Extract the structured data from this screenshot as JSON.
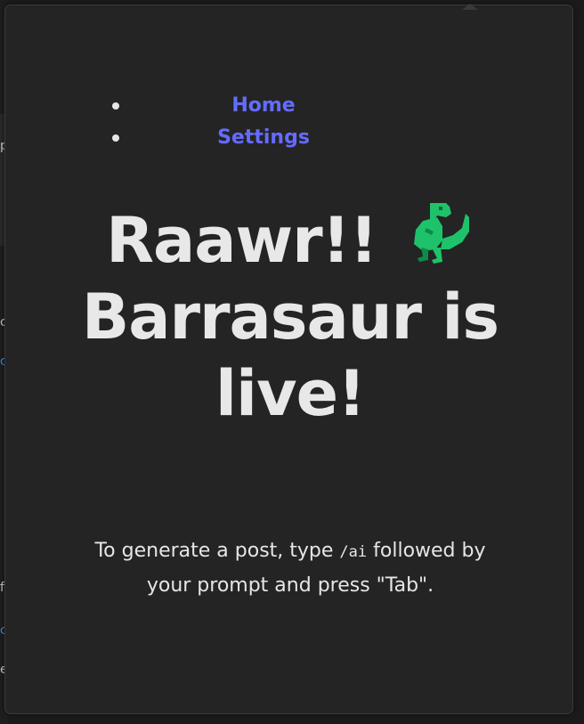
{
  "nav": {
    "items": [
      {
        "label": "Home"
      },
      {
        "label": "Settings"
      }
    ]
  },
  "headline": {
    "line1": "Raawr!!",
    "line2": "Barrasaur is",
    "line3": "live!",
    "icon": "t-rex-icon"
  },
  "hint": {
    "before_code": "To generate a post, type ",
    "code": "/ai",
    "after_code": " followed by your prompt and press \"Tab\"."
  },
  "colors": {
    "link": "#646cff",
    "text": "#e8e8e8",
    "background": "#242424",
    "dino": "#1ec26a"
  }
}
